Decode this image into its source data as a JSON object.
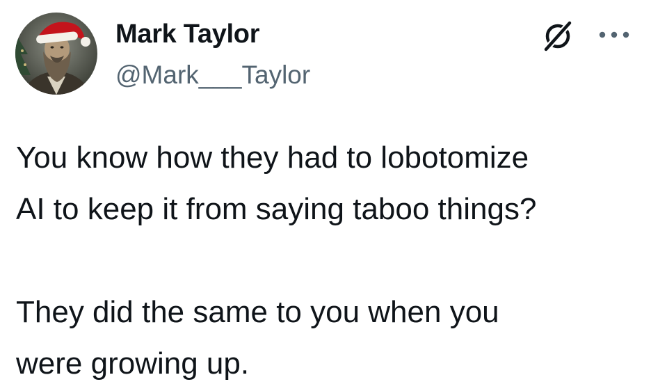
{
  "author": {
    "display_name": "Mark Taylor",
    "handle": "@Mark___Taylor",
    "avatar_icon": "bearded-man-santa-hat-avatar"
  },
  "header_actions": {
    "grok_icon": "grok-icon",
    "more_icon": "more-options-icon"
  },
  "tweet": {
    "paragraph1_line1": "You know how they had to lobotomize",
    "paragraph1_line2": "AI to keep it from saying taboo things?",
    "paragraph2_line1": "They did the same to you when you",
    "paragraph2_line2": "were growing up."
  },
  "colors": {
    "text": "#0f1419",
    "secondary": "#536471"
  }
}
